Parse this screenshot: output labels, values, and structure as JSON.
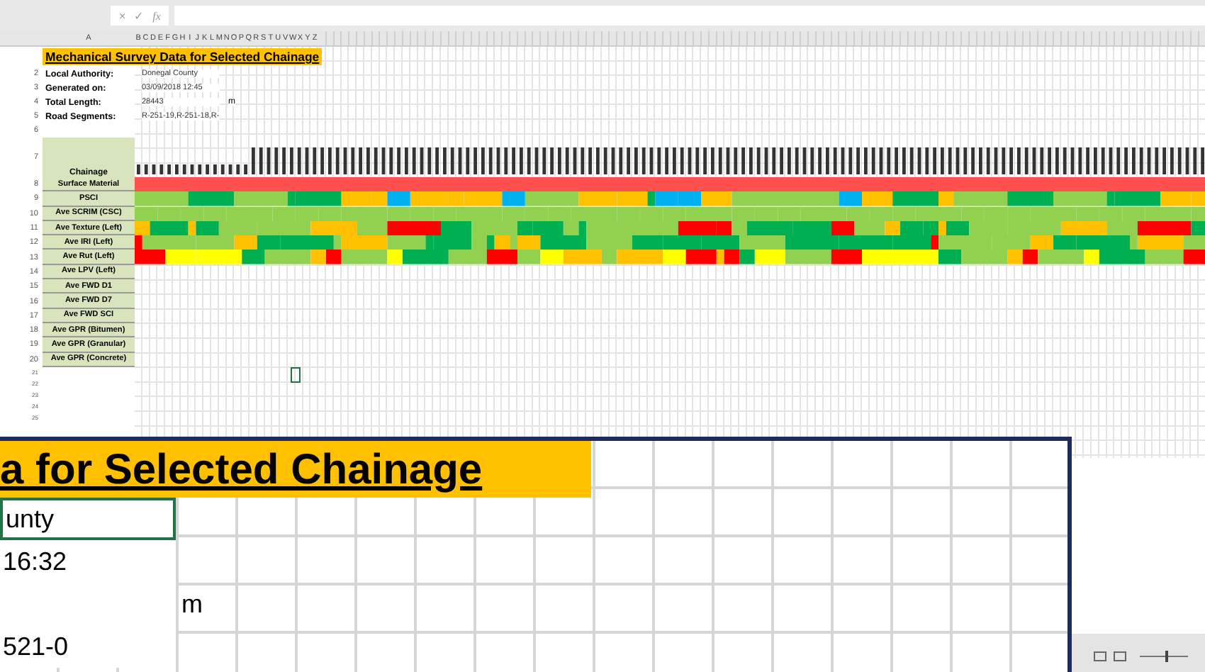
{
  "formula_bar": {
    "cancel": "×",
    "enter": "✓",
    "function": "fx"
  },
  "column_headers": [
    "A",
    "B",
    "C",
    "D",
    "E",
    "F",
    "G",
    "H",
    "I",
    "J",
    "K",
    "L",
    "M",
    "N",
    "O",
    "P",
    "Q",
    "R",
    "S",
    "T",
    "U",
    "V",
    "W",
    "X",
    "Y",
    "Z"
  ],
  "title": "Mechanical Survey Data for Selected Chainage",
  "info": [
    {
      "label": "Local Authority:",
      "value": "Donegal County"
    },
    {
      "label": "Generated on:",
      "value": "03/09/2018 12:45"
    },
    {
      "label": "Total Length:",
      "value": "28443",
      "unit": "m"
    },
    {
      "label": "Road Segments:",
      "value": "R-251-19,R-251-18,R-"
    }
  ],
  "chainage_label": "Chainage",
  "metrics": [
    "Surface Material",
    "PSCI",
    "Ave SCRIM (CSC)",
    "Ave Texture (Left)",
    "Ave IRI (Left)",
    "Ave Rut (Left)",
    "Ave LPV (Left)",
    "Ave FWD D1",
    "Ave FWD D7",
    "Ave FWD SCI",
    "Ave GPR (Bitumen)",
    "Ave GPR (Granular)",
    "Ave GPR (Concrete)"
  ],
  "row_numbers": [
    "2",
    "3",
    "4",
    "5",
    "6",
    "7",
    "8",
    "9",
    "10",
    "11",
    "12",
    "13",
    "14",
    "15",
    "16",
    "17",
    "18",
    "19",
    "20",
    "21",
    "22",
    "23",
    "24",
    "25"
  ],
  "inset": {
    "title": "a for Selected Chainage",
    "lines": [
      {
        "value": "unty",
        "selected": true
      },
      {
        "value": "16:32",
        "selected": false
      },
      {
        "unit": "m",
        "selected": false
      },
      {
        "value": "521-0",
        "selected": false
      }
    ]
  }
}
